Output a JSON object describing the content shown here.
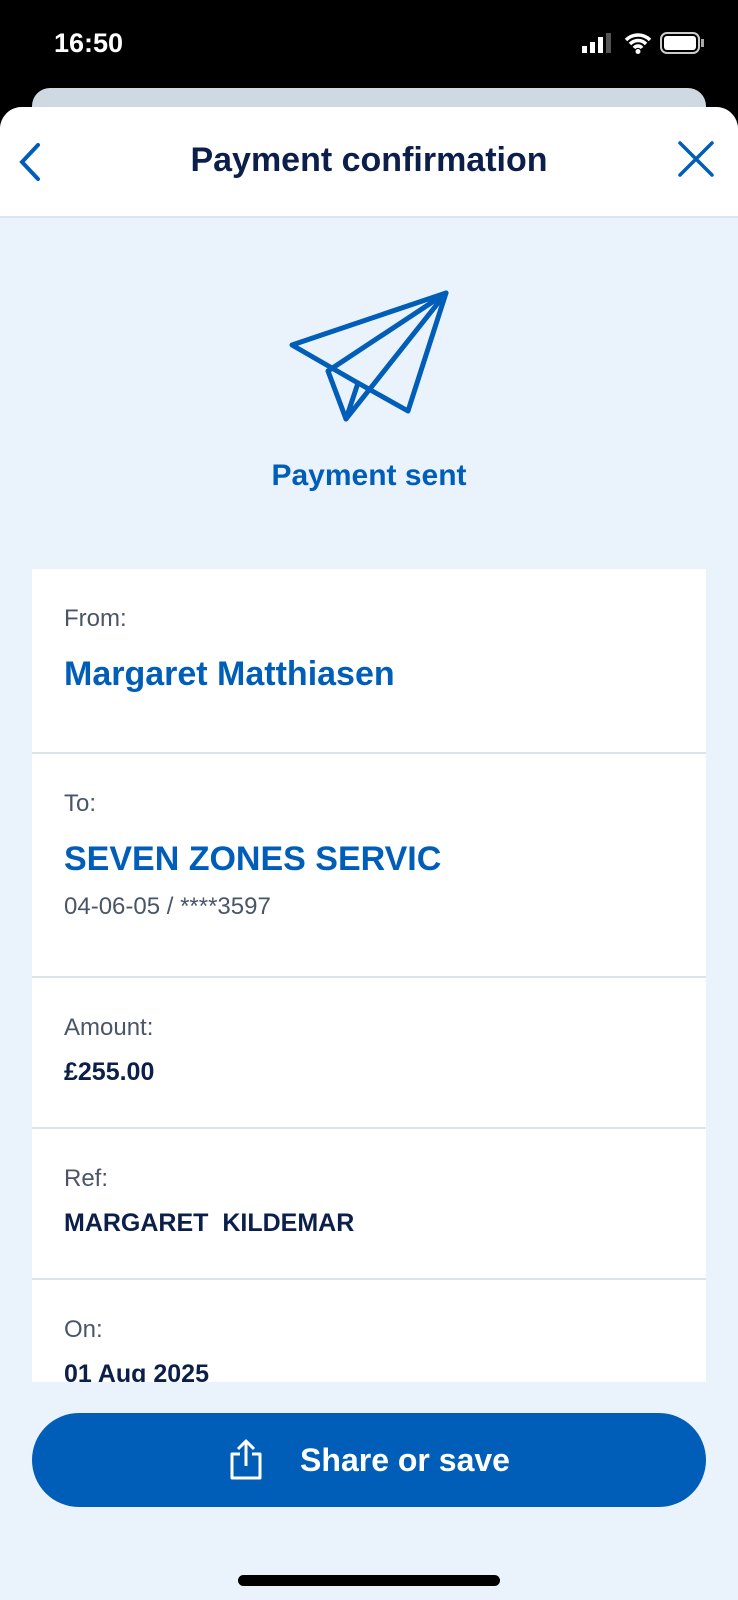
{
  "status_bar": {
    "time": "16:50",
    "icons": [
      "signal-icon",
      "wifi-icon",
      "battery-icon"
    ]
  },
  "header": {
    "title": "Payment confirmation",
    "back_icon": "chevron-left-icon",
    "close_icon": "close-icon"
  },
  "hero": {
    "icon": "paper-plane-icon",
    "status": "Payment sent"
  },
  "details": {
    "from": {
      "label": "From:",
      "name": "Margaret Matthiasen"
    },
    "to": {
      "label": "To:",
      "name": "SEVEN ZONES SERVIC",
      "account": "04-06-05 / ****3597"
    },
    "amount": {
      "label": "Amount:",
      "value": "£255.00"
    },
    "ref": {
      "label": "Ref:",
      "value": "MARGARET  KILDEMAR"
    },
    "on": {
      "label": "On:",
      "value": "01 Aug 2025"
    }
  },
  "actions": {
    "share_label": "Share or save",
    "share_icon": "share-icon"
  },
  "colors": {
    "accent": "#005eb8",
    "title": "#0c1f4a",
    "background": "#eaf3fc"
  }
}
